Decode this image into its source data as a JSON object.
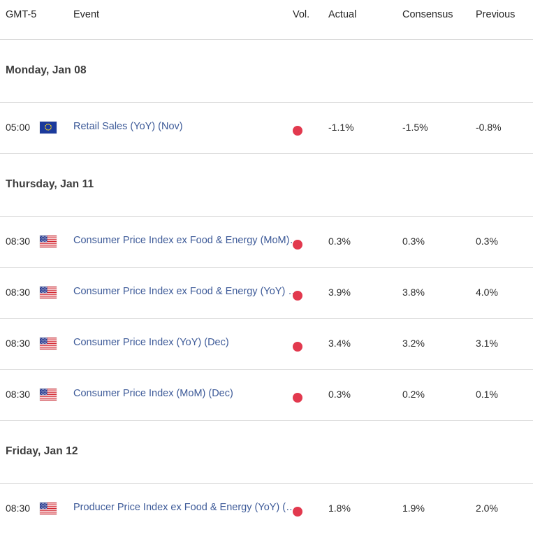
{
  "header": {
    "timezone": "GMT-5",
    "event": "Event",
    "vol": "Vol.",
    "actual": "Actual",
    "consensus": "Consensus",
    "previous": "Previous"
  },
  "colors": {
    "link": "#3d5a98",
    "volatility_high": "#e2394e",
    "divider": "#dcdcdc",
    "text": "#2b2b2b"
  },
  "groups": [
    {
      "date": "Monday, Jan 08",
      "rows": [
        {
          "time": "05:00",
          "flag": "eu-flag-icon",
          "country": "European Union",
          "event": "Retail Sales (YoY) (Nov)",
          "volatility": "high",
          "actual": "-1.1%",
          "consensus": "-1.5%",
          "previous": "-0.8%"
        }
      ]
    },
    {
      "date": "Thursday, Jan 11",
      "rows": [
        {
          "time": "08:30",
          "flag": "us-flag-icon",
          "country": "United States",
          "event": "Consumer Price Index ex Food & Energy (MoM) (Dec)",
          "volatility": "high",
          "actual": "0.3%",
          "consensus": "0.3%",
          "previous": "0.3%"
        },
        {
          "time": "08:30",
          "flag": "us-flag-icon",
          "country": "United States",
          "event": "Consumer Price Index ex Food & Energy (YoY) (Dec)",
          "volatility": "high",
          "actual": "3.9%",
          "consensus": "3.8%",
          "previous": "4.0%"
        },
        {
          "time": "08:30",
          "flag": "us-flag-icon",
          "country": "United States",
          "event": "Consumer Price Index (YoY) (Dec)",
          "volatility": "high",
          "actual": "3.4%",
          "consensus": "3.2%",
          "previous": "3.1%"
        },
        {
          "time": "08:30",
          "flag": "us-flag-icon",
          "country": "United States",
          "event": "Consumer Price Index (MoM) (Dec)",
          "volatility": "high",
          "actual": "0.3%",
          "consensus": "0.2%",
          "previous": "0.1%"
        }
      ]
    },
    {
      "date": "Friday, Jan 12",
      "rows": [
        {
          "time": "08:30",
          "flag": "us-flag-icon",
          "country": "United States",
          "event": "Producer Price Index ex Food & Energy (YoY) (Dec)",
          "volatility": "high",
          "actual": "1.8%",
          "consensus": "1.9%",
          "previous": "2.0%"
        }
      ]
    }
  ]
}
